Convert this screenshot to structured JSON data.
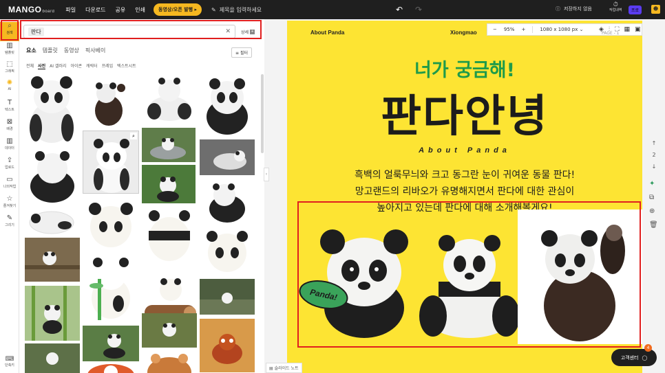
{
  "topbar": {
    "logo": "MANGO",
    "logo_suffix": "board",
    "menu": [
      "파일",
      "다운로드",
      "공유",
      "인쇄"
    ],
    "promo_pill": "동영상/오픈 발행 ▸",
    "title_placeholder": "제목을 입력하세요",
    "save_status": "저장하지 않음",
    "history_label": "작업내역",
    "plan_label": "프로"
  },
  "rail": {
    "items": [
      {
        "label": "검색",
        "icon": "search-icon"
      },
      {
        "label": "템플릿",
        "icon": "template-icon"
      },
      {
        "label": "그래픽",
        "icon": "graphic-icon"
      },
      {
        "label": "AI",
        "icon": "ai-icon"
      },
      {
        "label": "텍스트",
        "icon": "text-icon"
      },
      {
        "label": "배경",
        "icon": "background-icon"
      },
      {
        "label": "데이터",
        "icon": "chart-icon"
      },
      {
        "label": "업로드",
        "icon": "upload-icon"
      },
      {
        "label": "나의작업",
        "icon": "folder-icon"
      },
      {
        "label": "즐겨찾기",
        "icon": "star-icon"
      },
      {
        "label": "그리기",
        "icon": "draw-icon"
      }
    ],
    "bottom_label": "단축키"
  },
  "search": {
    "query": "판다",
    "detail_label": "상세"
  },
  "tabs": [
    "요소",
    "템플릿",
    "동영상",
    "픽사베이"
  ],
  "filter_label": "필터",
  "subtabs": [
    "전체",
    "사진",
    "AI 갤러리",
    "아이콘",
    "캐릭터",
    "프레임",
    "텍스트시트"
  ],
  "canvas": {
    "header_left": "About Panda",
    "header_right": "Xiongmao",
    "zoom": "95%",
    "size": "1080 x 1080 px",
    "page_label": "PAGE - 1",
    "subtitle": "너가 궁금해!",
    "headline": "판다안녕",
    "about": "About Panda",
    "body_lines": [
      "흑백의 얼룩무늬와 크고 동그란 눈이 귀여운 동물 판다!",
      "망고랜드의 리바오가 유명해지면서 판다에 대한 관심이",
      "높아지고 있는데 판다에 대해 소개해볼게요!"
    ],
    "sticker_text": "Panda!"
  },
  "side_nav": {
    "up": "↑",
    "page": "2",
    "down": "↓"
  },
  "support": {
    "label": "고객센터",
    "badge": "4"
  },
  "notes_label": "슬라이드 노트"
}
